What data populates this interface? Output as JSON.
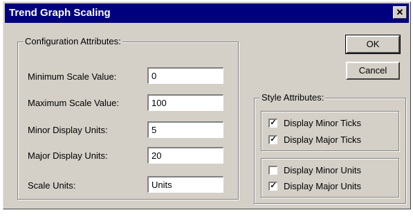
{
  "window": {
    "title": "Trend Graph Scaling",
    "close_glyph": "✕"
  },
  "config": {
    "legend": "Configuration Attributes:",
    "fields": [
      {
        "label": "Minimum Scale Value:",
        "value": "0"
      },
      {
        "label": "Maximum Scale Value:",
        "value": "100"
      },
      {
        "label": "Minor Display Units:",
        "value": "5"
      },
      {
        "label": "Major Display Units:",
        "value": "20"
      },
      {
        "label": "Scale Units:",
        "value": "Units"
      }
    ]
  },
  "buttons": {
    "ok": "OK",
    "cancel": "Cancel"
  },
  "style": {
    "legend": "Style Attributes:",
    "ticks": [
      {
        "label": "Display Minor Ticks",
        "checked": true
      },
      {
        "label": "Display Major Ticks",
        "checked": true
      }
    ],
    "units": [
      {
        "label": "Display Minor Units",
        "checked": false
      },
      {
        "label": "Display Major Units",
        "checked": true
      }
    ]
  },
  "icons": {
    "check": "check-icon",
    "close": "close-icon"
  }
}
